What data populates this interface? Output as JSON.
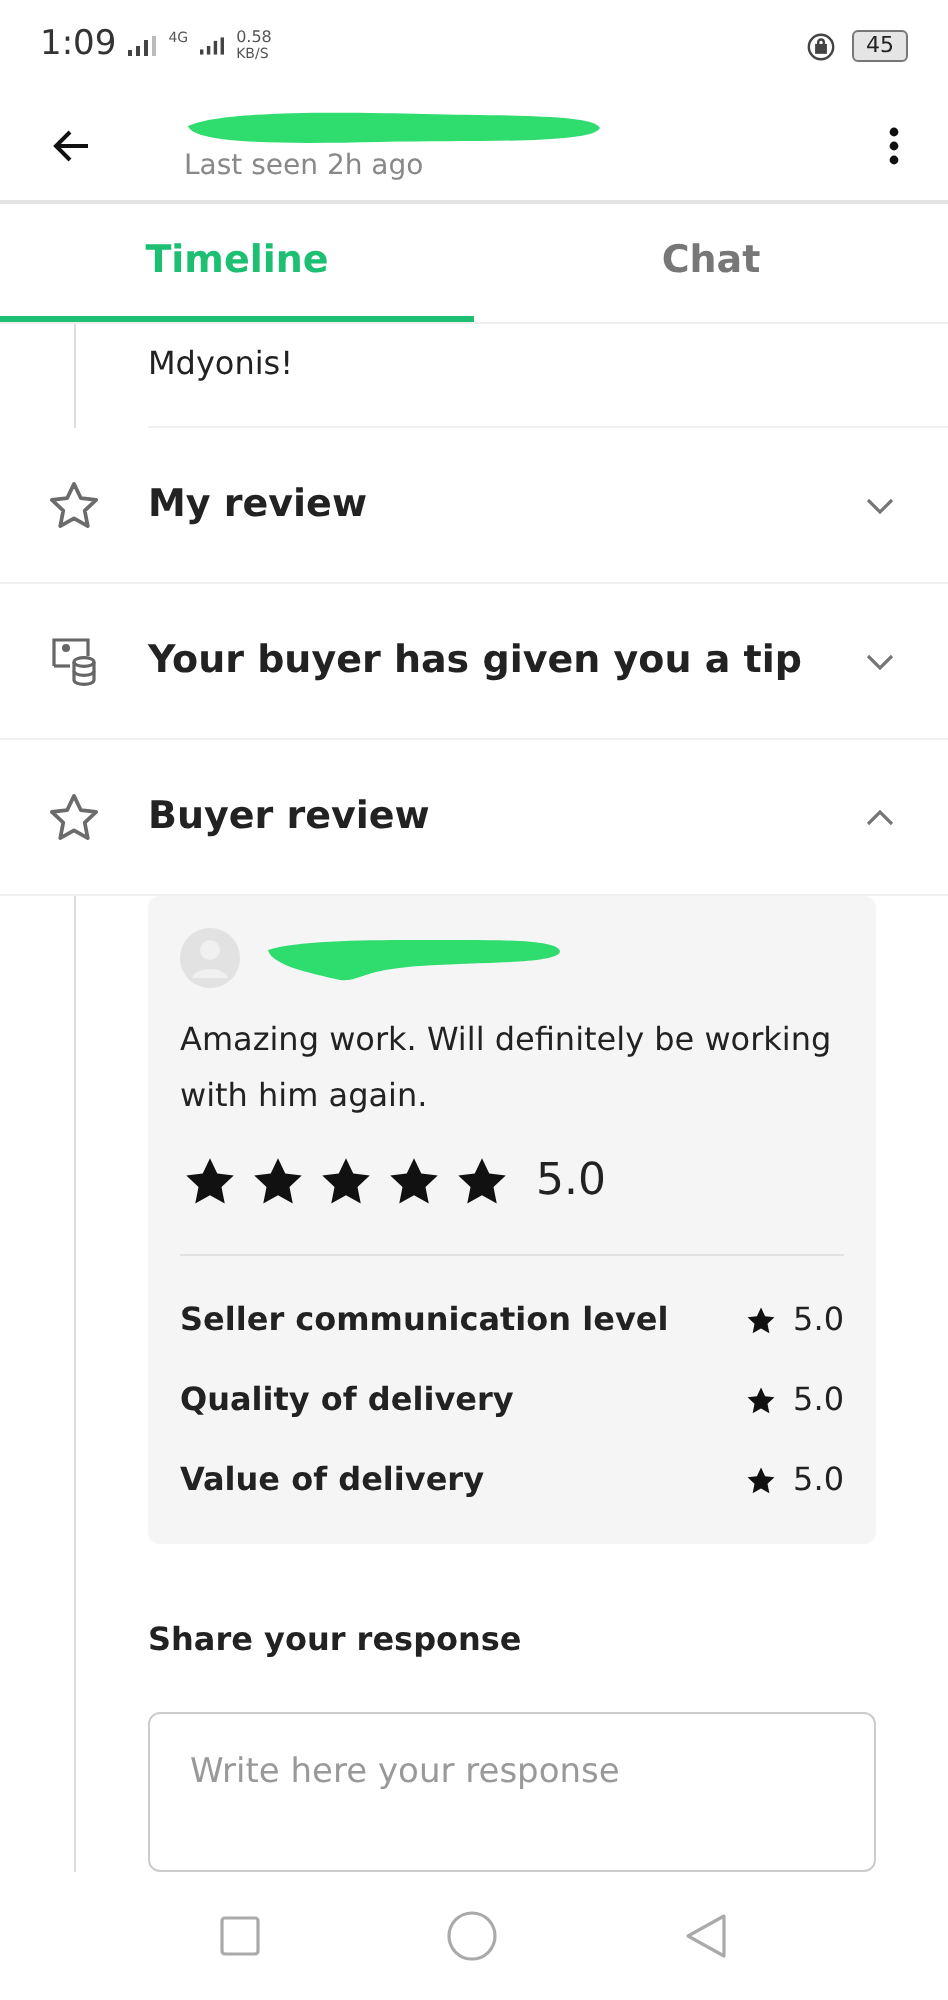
{
  "status_bar": {
    "time": "1:09",
    "network": "4G",
    "speed": "0.58",
    "speed_unit": "KB/S",
    "battery": "45"
  },
  "header": {
    "subtitle": "Last seen 2h ago"
  },
  "tabs": [
    {
      "label": "Timeline",
      "selected": true
    },
    {
      "label": "Chat",
      "selected": false
    }
  ],
  "timeline": {
    "message_tail": "Mdyonis!",
    "sections": [
      {
        "kind": "review",
        "title": "My review",
        "expanded": false
      },
      {
        "kind": "tip",
        "title": "Your buyer has given you a tip",
        "expanded": false
      },
      {
        "kind": "review",
        "title": "Buyer review",
        "expanded": true
      }
    ]
  },
  "review_card": {
    "text": "Amazing work. Will definitely be working with him again.",
    "stars": 5,
    "rating": "5.0",
    "criteria": [
      {
        "label": "Seller communication level",
        "rating": "5.0"
      },
      {
        "label": "Quality of delivery",
        "rating": "5.0"
      },
      {
        "label": "Value of delivery",
        "rating": "5.0"
      }
    ]
  },
  "response": {
    "label": "Share your response",
    "placeholder": "Write here your response"
  }
}
